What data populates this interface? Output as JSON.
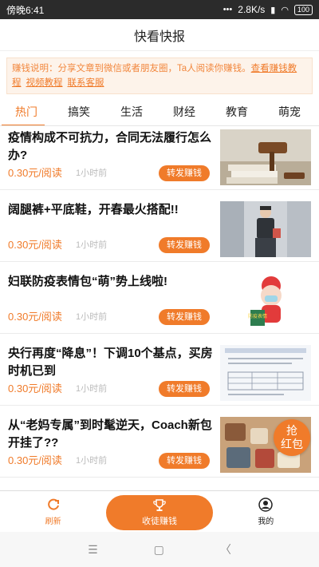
{
  "status": {
    "time": "傍晚6:41",
    "speed": "2.8K/s",
    "battery": "100"
  },
  "appbar": {
    "title": "快看快报"
  },
  "notice": {
    "text": "赚钱说明：分享文章到微信或者朋友圈，Ta人阅读你赚钱。",
    "links": [
      "查看赚钱教程",
      "视频教程",
      "联系客服"
    ]
  },
  "tabs": [
    {
      "label": "热门",
      "active": true
    },
    {
      "label": "搞笑"
    },
    {
      "label": "生活"
    },
    {
      "label": "财经"
    },
    {
      "label": "教育"
    },
    {
      "label": "萌宠"
    }
  ],
  "articles": [
    {
      "title": "疫情构成不可抗力，合同无法履行怎么办?",
      "price": "0.30元/阅读",
      "ago": "1小时前",
      "share": "转发赚钱"
    },
    {
      "title": "阔腿裤+平底鞋，开春最火搭配!!",
      "price": "0.30元/阅读",
      "ago": "1小时前",
      "share": "转发赚钱"
    },
    {
      "title": "妇联防疫表情包“萌”势上线啦!",
      "price": "0.30元/阅读",
      "ago": "1小时前",
      "share": "转发赚钱"
    },
    {
      "title": "央行再度“降息”！下调10个基点，买房时机已到",
      "price": "0.30元/阅读",
      "ago": "1小时前",
      "share": "转发赚钱"
    },
    {
      "title": "从“老妈专属”到时髦逆天，Coach新包开挂了??",
      "price": "0.30元/阅读",
      "ago": "1小时前",
      "share": "转发赚钱"
    }
  ],
  "thumb3_text": "防疫表情",
  "redpacket": {
    "line1": "抢",
    "line2": "红包"
  },
  "bottomnav": {
    "refresh": "刷新",
    "earn": "收徒赚钱",
    "me": "我的"
  },
  "colors": {
    "accent": "#f07b2a"
  }
}
